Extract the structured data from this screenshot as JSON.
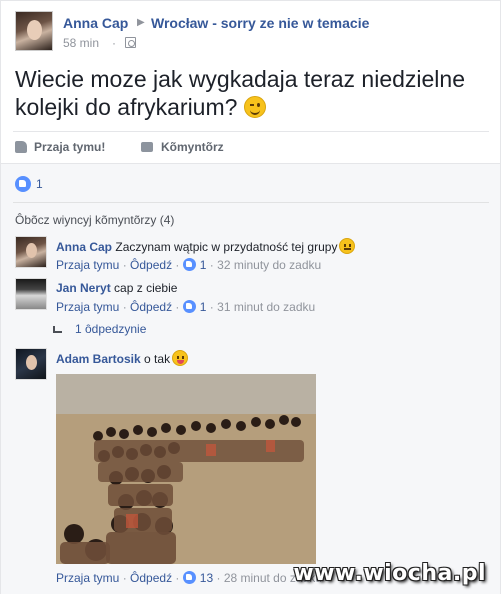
{
  "post": {
    "author": "Anna Cap",
    "group": "Wrocław - sorry ze nie w temacie",
    "time": "58 min",
    "meta_sep": "·",
    "text": "Wiecie moze jak wygkadaja teraz niedzielne kolejki do afrykarium?",
    "emoji_icon": "wink-emoji-icon"
  },
  "actions": {
    "like_label": "Przaja tymu!",
    "comment_label": "Kõmyntõrz"
  },
  "likes": {
    "count": "1"
  },
  "comments_section": {
    "view_more": "Ôbõcz wiyncyj kõmyntõrzy (4)",
    "comments": [
      {
        "name": "Anna Cap",
        "text": "Zaczynam wątpic w przydatność tej grupy",
        "like_label": "Przaja tymu",
        "reply_label": "Ôdpedź",
        "likes": "1",
        "time": "32 minuty do zadku"
      },
      {
        "name": "Jan Neryt",
        "text": "cap z ciebie",
        "like_label": "Przaja tymu",
        "reply_label": "Ôdpedź",
        "likes": "1",
        "time": "31 minut do zadku"
      },
      {
        "name": "Adam Bartosik",
        "text": "o tak",
        "like_label": "Przaja tymu",
        "reply_label": "Ôdpedź",
        "likes": "13",
        "time": "28 minut do zadku"
      }
    ],
    "replies_label": "1 ôdpedzynie",
    "separator": "·"
  },
  "watermark": "www.wiocha.pl",
  "colors": {
    "link": "#365899",
    "meta": "#90949c",
    "like_blue": "#5890ff",
    "comments_bg": "#f6f7f9"
  }
}
